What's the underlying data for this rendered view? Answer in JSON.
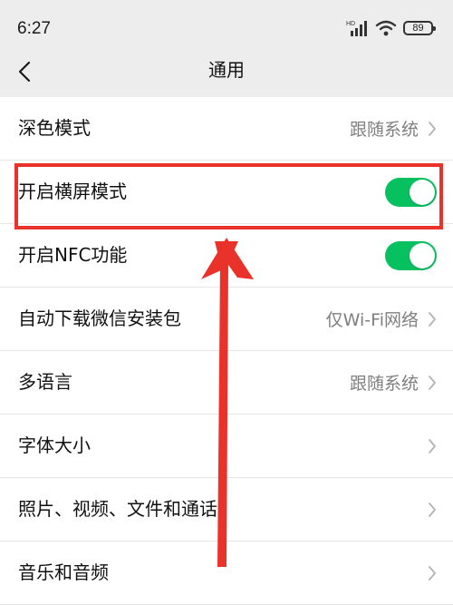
{
  "status_bar": {
    "time": "6:27",
    "battery_level": "89",
    "signal_label": "HD"
  },
  "nav": {
    "title": "通用"
  },
  "settings": [
    {
      "label": "深色模式",
      "value": "跟随系统",
      "type": "link"
    },
    {
      "label": "开启横屏模式",
      "type": "toggle",
      "on": true
    },
    {
      "label": "开启NFC功能",
      "type": "toggle",
      "on": true
    },
    {
      "label": "自动下载微信安装包",
      "value": "仅Wi-Fi网络",
      "type": "link"
    },
    {
      "label": "多语言",
      "value": "跟随系统",
      "type": "link"
    },
    {
      "label": "字体大小",
      "type": "link"
    },
    {
      "label": "照片、视频、文件和通话",
      "type": "link"
    },
    {
      "label": "音乐和音频",
      "type": "link"
    }
  ],
  "colors": {
    "toggle_on": "#07c160",
    "highlight": "#e8322a",
    "header_bg": "#ededed",
    "value_text": "#7f7f7f"
  }
}
